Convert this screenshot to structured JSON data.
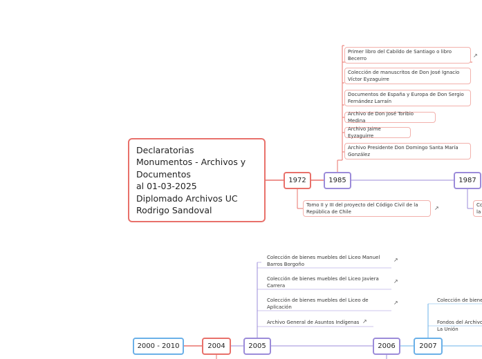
{
  "root": {
    "title": "Declaratorias\nMonumentos - Archivos y\nDocumentos\nal 01-03-2025\nDiplomado Archivos UC\nRodrigo Sandoval"
  },
  "years": {
    "y1972": "1972",
    "y1985": "1985",
    "y1987": "1987",
    "y2000_2010": "2000 - 2010",
    "y2004": "2004",
    "y2005": "2005",
    "y2006": "2006",
    "y2007": "2007"
  },
  "items_1985": [
    "Primer libro del Cabildo de Santiago o libro Becerro",
    "Colección de manuscritos de Don José Ignacio Víctor Eyzaguirre",
    "Documentos de España y Europa de Don Sergio Fernández Larraín",
    "Archivo de Don José Toribio Medina",
    "Archivo Jaime Eyzaguirre",
    "Archivo Presidente Don Domingo Santa María González"
  ],
  "item_1972": "Tomo II y III del proyecto del Código Civil de la República de Chile",
  "item_1987": "Co\nla",
  "items_2005": [
    "Colección de bienes muebles del Liceo Manuel Barros Borgoño",
    "Colección de bienes muebles del Liceo Javiera Carrera",
    "Colección de bienes muebles del Liceo de Aplicación",
    "Archivo General de Asuntos Indígenas"
  ],
  "items_2007": [
    "Colección de bienes",
    "Fondos del Archivo\nLa Unión"
  ],
  "colors": {
    "red": "#e8706a",
    "purple": "#9b8bd9",
    "blue": "#6ab0e8",
    "leafBorder": "#f2b0ab"
  },
  "icons": {
    "external": "external-link-icon"
  }
}
